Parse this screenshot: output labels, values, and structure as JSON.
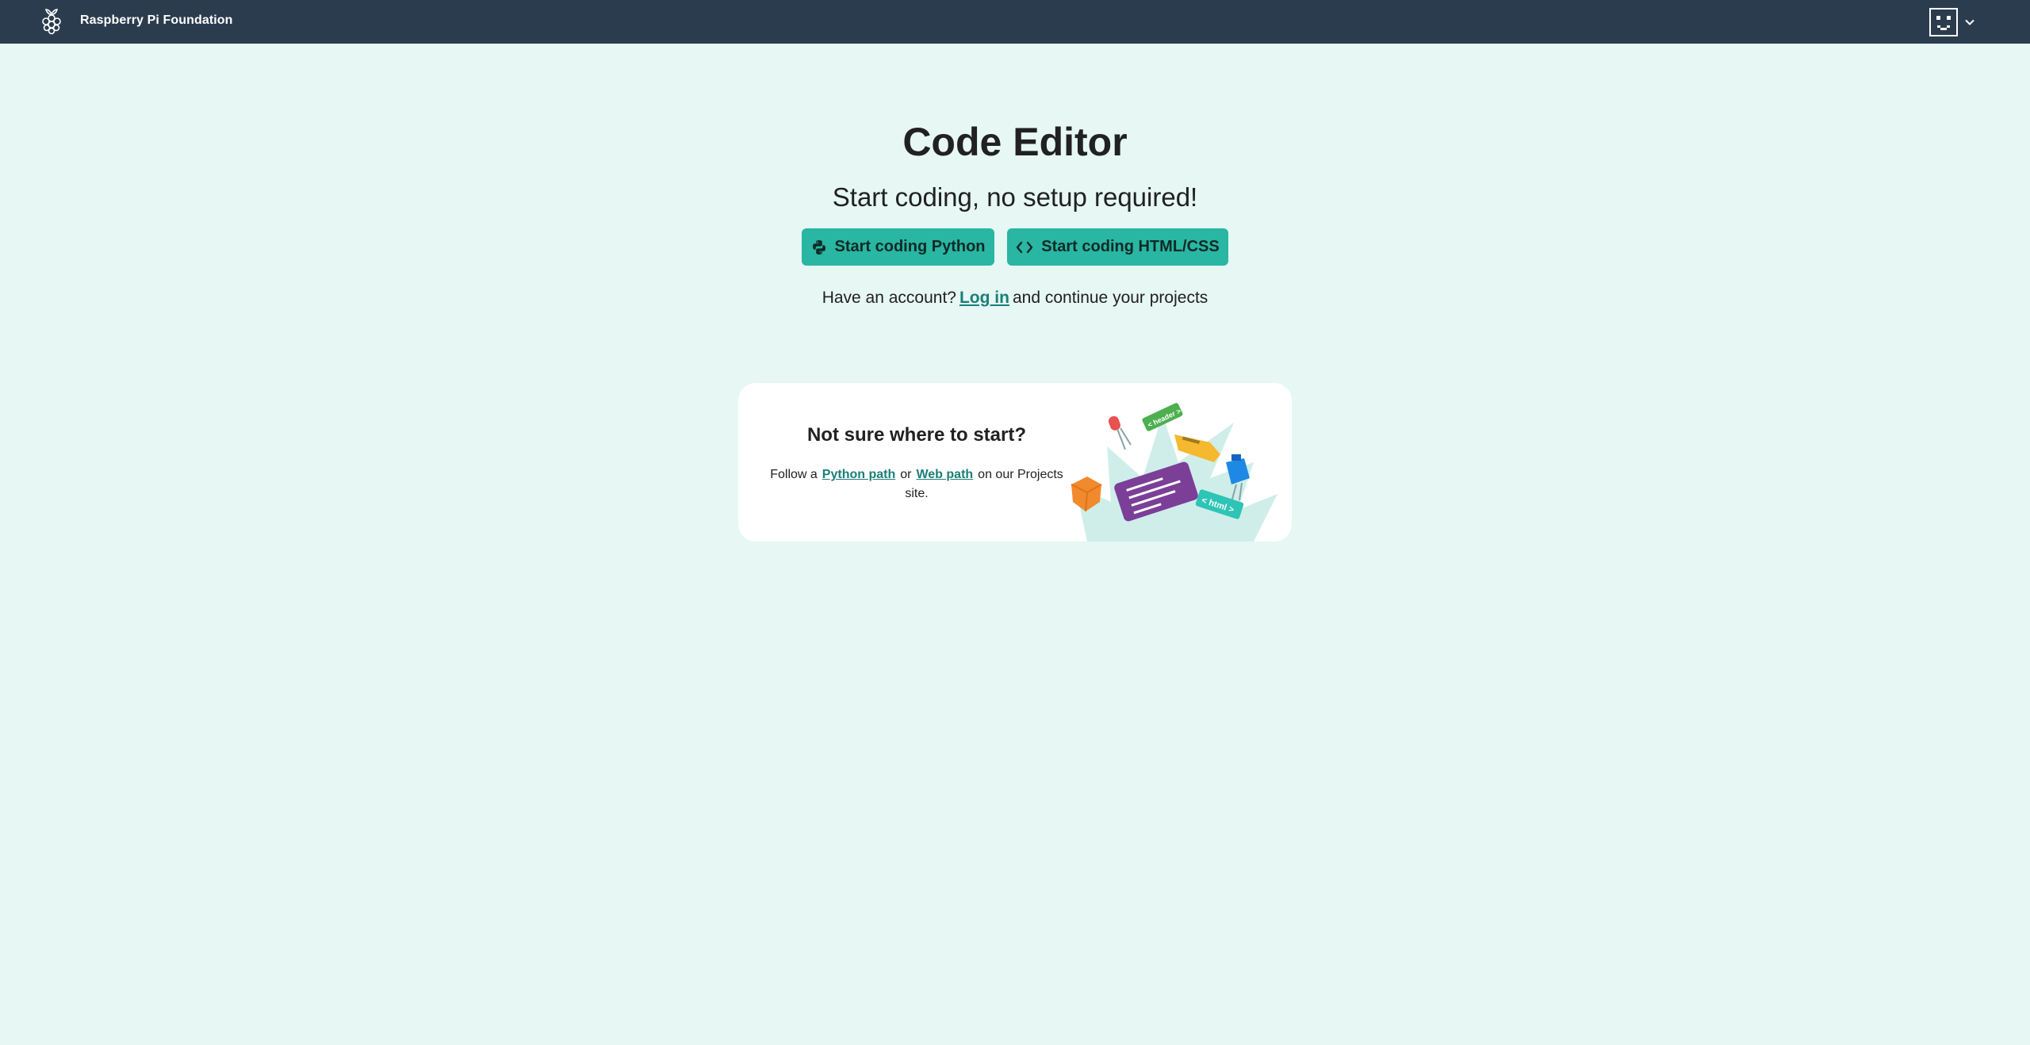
{
  "header": {
    "brand": "Raspberry Pi Foundation",
    "logo_icon": "raspberry-pi-logo-icon",
    "account_icon": "user-avatar-icon",
    "dropdown_icon": "chevron-down-icon"
  },
  "hero": {
    "title": "Code Editor",
    "subtitle": "Start coding, no setup required!",
    "python_button": "Start coding Python",
    "html_button": "Start coding HTML/CSS",
    "login_prefix": "Have an account?",
    "login_link": "Log in",
    "login_suffix": "and continue your projects"
  },
  "card": {
    "title": "Not sure where to start?",
    "text_prefix": "Follow a",
    "python_link": "Python path",
    "text_or": "or",
    "web_link": "Web path",
    "text_suffix": "on our Projects site.",
    "illustration_tags": [
      "< header >",
      "< html >"
    ]
  },
  "colors": {
    "topbar": "#2b3c4e",
    "background": "#e6f7f4",
    "button": "#29b6a3",
    "link": "#1b7f77"
  }
}
